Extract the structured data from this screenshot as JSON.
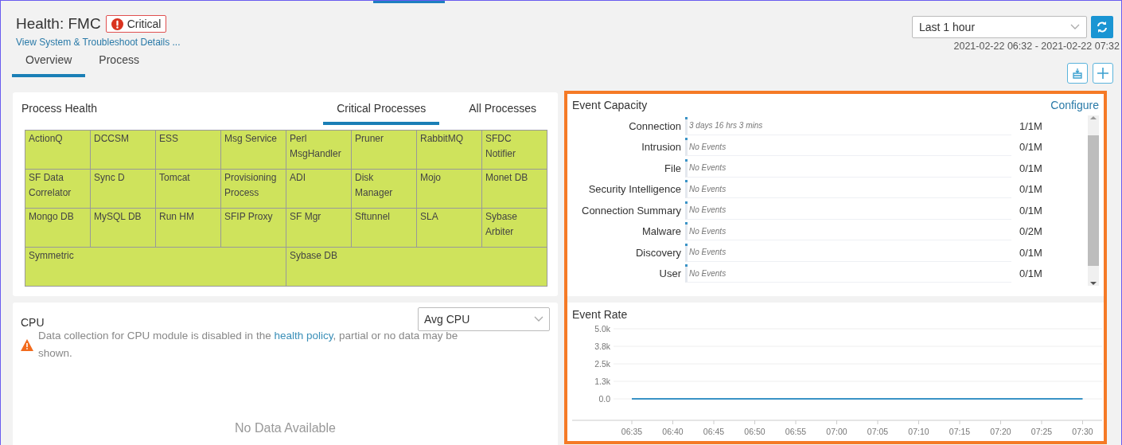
{
  "header": {
    "title": "Health: FMC",
    "status": {
      "label": "Critical",
      "kind": "critical"
    },
    "link": "View System & Troubleshoot Details ..."
  },
  "tabs": [
    {
      "label": "Overview",
      "selected": true
    },
    {
      "label": "Process",
      "selected": false
    }
  ],
  "time_range": {
    "value": "Last 1 hour",
    "range": "2021-02-22 06:32 - 2021-02-22 07:32"
  },
  "process_health": {
    "title": "Process Health",
    "tabs": [
      {
        "label": "Critical Processes",
        "selected": true
      },
      {
        "label": "All Processes",
        "selected": false
      }
    ],
    "processes": [
      {
        "name": "ActionQ"
      },
      {
        "name": "DCCSM"
      },
      {
        "name": "ESS"
      },
      {
        "name": "Msg Service"
      },
      {
        "name": "Perl MsgHandler"
      },
      {
        "name": "Pruner"
      },
      {
        "name": "RabbitMQ"
      },
      {
        "name": "SFDC Notifier"
      },
      {
        "name": "SF Data Correlator"
      },
      {
        "name": "Sync D"
      },
      {
        "name": "Tomcat"
      },
      {
        "name": "Provisioning Process"
      },
      {
        "name": "ADI"
      },
      {
        "name": "Disk Manager"
      },
      {
        "name": "Mojo"
      },
      {
        "name": "Monet DB"
      },
      {
        "name": "Mongo DB"
      },
      {
        "name": "MySQL DB"
      },
      {
        "name": "Run HM"
      },
      {
        "name": "SFIP Proxy"
      },
      {
        "name": "SF Mgr"
      },
      {
        "name": "Sftunnel"
      },
      {
        "name": "SLA"
      },
      {
        "name": "Sybase Arbiter"
      },
      {
        "name": "Symmetric",
        "wide": true
      },
      {
        "name": "Sybase DB",
        "wide": true
      }
    ]
  },
  "cpu": {
    "title": "CPU",
    "select": "Avg CPU",
    "warning_before": "Data collection for CPU module is disabled in the ",
    "warning_link": "health policy",
    "warning_after": ", partial or no data may be shown.",
    "empty": "No Data Available"
  },
  "event_capacity": {
    "title": "Event Capacity",
    "action": "Configure",
    "rows": [
      {
        "name": "Connection",
        "detail": "3 days 16 hrs 3 mins",
        "count": "1/1M",
        "level": 0
      },
      {
        "name": "Intrusion",
        "detail": "No Events",
        "count": "0/1M",
        "level": 0
      },
      {
        "name": "File",
        "detail": "No Events",
        "count": "0/1M",
        "level": 0
      },
      {
        "name": "Security Intelligence",
        "detail": "No Events",
        "count": "0/1M",
        "level": 0
      },
      {
        "name": "Connection Summary",
        "detail": "No Events",
        "count": "0/1M",
        "level": 0
      },
      {
        "name": "Malware",
        "detail": "No Events",
        "count": "0/2M",
        "level": 0
      },
      {
        "name": "Discovery",
        "detail": "No Events",
        "count": "0/1M",
        "level": 0
      },
      {
        "name": "User",
        "detail": "No Events",
        "count": "0/1M",
        "level": 0
      }
    ]
  },
  "event_rate": {
    "title": "Event Rate",
    "chart_data": {
      "type": "line",
      "x": [
        "06:35",
        "06:40",
        "06:45",
        "06:50",
        "06:55",
        "07:00",
        "07:05",
        "07:10",
        "07:15",
        "07:20",
        "07:25",
        "07:30"
      ],
      "series": [
        {
          "color": "#3a93c6",
          "values": [
            0,
            0,
            0,
            0,
            0,
            0,
            0,
            0,
            0,
            0,
            0,
            0
          ]
        }
      ],
      "ylim": [
        0,
        5000
      ],
      "grid": true,
      "yticks": [
        {
          "value": 0,
          "label": "0.0"
        },
        {
          "value": 1250,
          "label": "1.3k"
        },
        {
          "value": 2500,
          "label": "2.5k"
        },
        {
          "value": 3750,
          "label": "3.8k"
        },
        {
          "value": 5000,
          "label": "5.0k"
        }
      ]
    }
  }
}
